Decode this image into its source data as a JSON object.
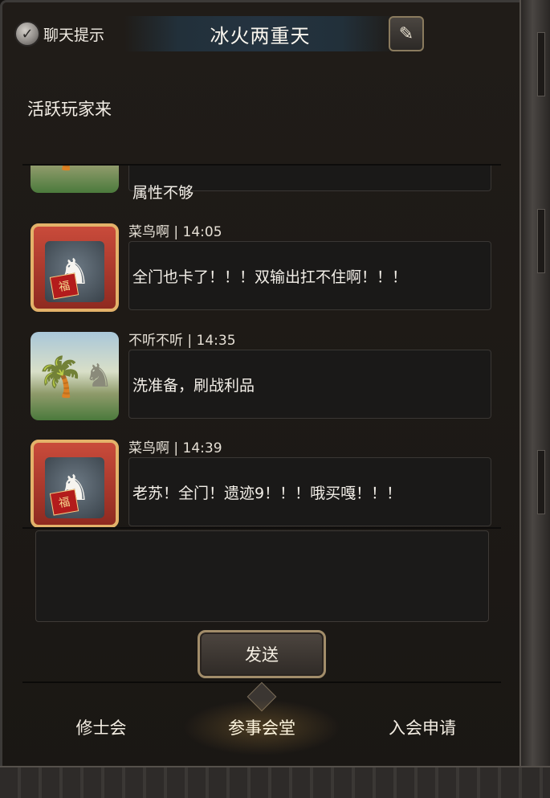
{
  "header": {
    "chat_tip_label": "聊天提示",
    "title": "冰火两重天"
  },
  "notice": "活跃玩家来",
  "messages": [
    {
      "partial": true,
      "avatar": "palm-statue-avatar",
      "text": "属性不够"
    },
    {
      "user": "菜鸟啊",
      "time": "14:05",
      "meta": "菜鸟啊 | 14:05",
      "avatar": "horse-avatar",
      "text": "全门也卡了！！！双输出扛不住啊！！！"
    },
    {
      "user": "不听不听",
      "time": "14:35",
      "meta": "不听不听 | 14:35",
      "avatar": "palm-statue-avatar",
      "text": "洗准备，刷战利品"
    },
    {
      "user": "菜鸟啊",
      "time": "14:39",
      "meta": "菜鸟啊 | 14:39",
      "avatar": "horse-avatar",
      "text": "老苏！全门！遗迹9！！！哦买嘎！！！"
    }
  ],
  "input": {
    "value": ""
  },
  "send_label": "发送",
  "tabs": [
    {
      "label": "修士会",
      "active": false
    },
    {
      "label": "参事会堂",
      "active": true
    },
    {
      "label": "入会申请",
      "active": false
    }
  ],
  "colors": {
    "panel": "#1a1714",
    "accent_border": "#a28d6a",
    "bubble": "#1a1918"
  }
}
